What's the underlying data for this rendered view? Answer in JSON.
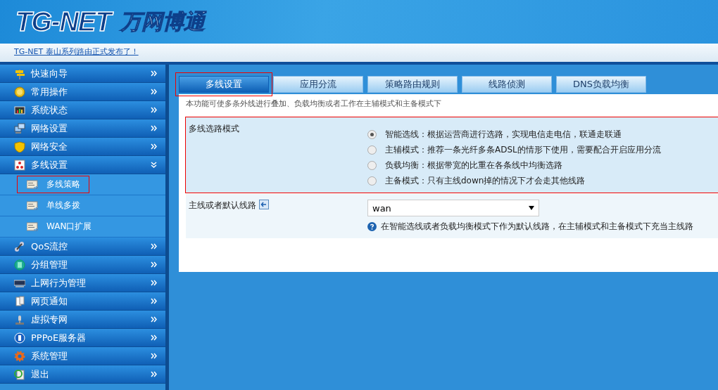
{
  "header": {
    "logo_mark": "TG-NET",
    "logo_text": "万网博通",
    "notice": "TG-NET 泰山系列路由正式发布了！"
  },
  "sidebar": {
    "items": [
      {
        "label": "快速向导",
        "expanded": false
      },
      {
        "label": "常用操作",
        "expanded": false
      },
      {
        "label": "系统状态",
        "expanded": false
      },
      {
        "label": "网络设置",
        "expanded": false
      },
      {
        "label": "网络安全",
        "expanded": false
      },
      {
        "label": "多线设置",
        "expanded": true,
        "children": [
          {
            "label": "多线策略",
            "selected": true
          },
          {
            "label": "单线多拨",
            "selected": false
          },
          {
            "label": "WAN口扩展",
            "selected": false
          }
        ]
      },
      {
        "label": "QoS流控",
        "expanded": false
      },
      {
        "label": "分组管理",
        "expanded": false
      },
      {
        "label": "上网行为管理",
        "expanded": false
      },
      {
        "label": "网页通知",
        "expanded": false
      },
      {
        "label": "虚拟专网",
        "expanded": false
      },
      {
        "label": "PPPoE服务器",
        "expanded": false
      },
      {
        "label": "系统管理",
        "expanded": false
      },
      {
        "label": "退出",
        "expanded": false
      }
    ]
  },
  "tabs": [
    {
      "label": "多线设置",
      "selected": true
    },
    {
      "label": "应用分流",
      "selected": false
    },
    {
      "label": "策略路由规则",
      "selected": false
    },
    {
      "label": "线路侦测",
      "selected": false
    },
    {
      "label": "DNS负载均衡",
      "selected": false
    }
  ],
  "description": "本功能可使多条外线进行叠加、负载均衡或者工作在主辅模式和主备模式下",
  "form": {
    "mode": {
      "label": "多线选路模式",
      "marked": true,
      "options": [
        {
          "label": "智能选线：根据运营商进行选路，实现电信走电信，联通走联通",
          "selected": true
        },
        {
          "label": "主辅模式：推荐一条光纤多条ADSL的情形下使用，需要配合开启应用分流",
          "selected": false
        },
        {
          "label": "负载均衡：根据带宽的比重在各条线中均衡选路",
          "selected": false
        },
        {
          "label": "主备模式：只有主线down掉的情况下才会走其他线路",
          "selected": false
        }
      ]
    },
    "default_line": {
      "label": "主线或者默认线路",
      "value": "wan",
      "help": "在智能选线或者负载均衡模式下作为默认线路，在主辅模式和主备模式下充当主线路"
    }
  }
}
